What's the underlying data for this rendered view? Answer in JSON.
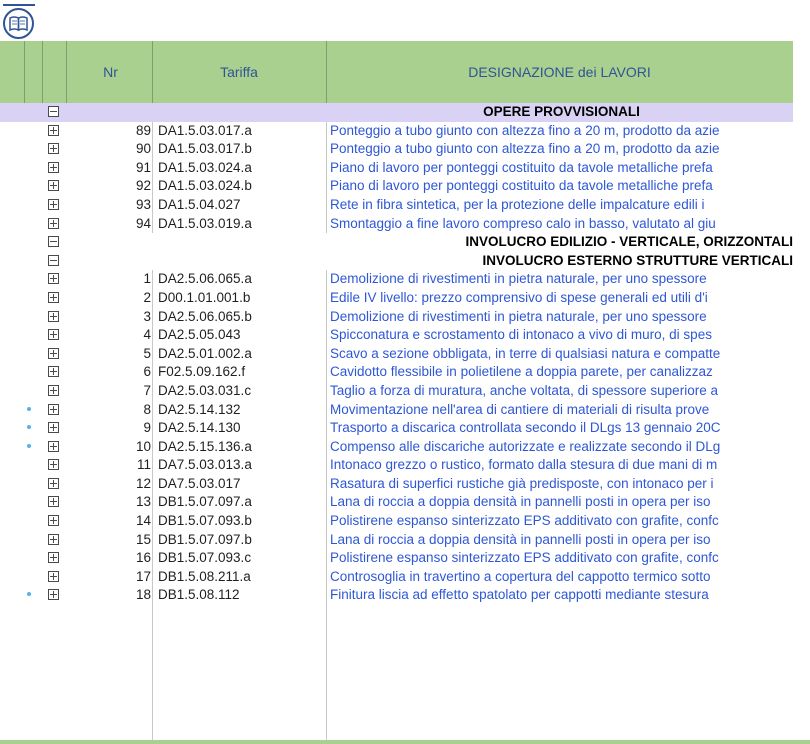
{
  "header": {
    "nr": "Nr",
    "tariffa": "Tariffa",
    "designazione": "DESIGNAZIONE dei LAVORI"
  },
  "rows": [
    {
      "kind": "section",
      "toggle": "minus",
      "title": "OPERE PROVVISIONALI",
      "align": "center",
      "highlight": true
    },
    {
      "kind": "item",
      "nr": "89",
      "tariffa": "DA1.5.03.017.a",
      "desc": "Ponteggio a tubo giunto con altezza fino a 20 m, prodotto da azie"
    },
    {
      "kind": "item",
      "nr": "90",
      "tariffa": "DA1.5.03.017.b",
      "desc": "Ponteggio a tubo giunto con altezza fino a 20 m, prodotto da azie"
    },
    {
      "kind": "item",
      "nr": "91",
      "tariffa": "DA1.5.03.024.a",
      "desc": "Piano di lavoro per ponteggi costituito da tavole metalliche prefa"
    },
    {
      "kind": "item",
      "nr": "92",
      "tariffa": "DA1.5.03.024.b",
      "desc": "Piano di lavoro per ponteggi costituito da tavole metalliche prefa"
    },
    {
      "kind": "item",
      "nr": "93",
      "tariffa": "DA1.5.04.027",
      "desc": "Rete in fibra sintetica, per la protezione delle impalcature edili i"
    },
    {
      "kind": "item",
      "nr": "94",
      "tariffa": "DA1.5.03.019.a",
      "desc": "Smontaggio a fine lavoro compreso calo in basso, valutato al giu"
    },
    {
      "kind": "section",
      "toggle": "minus",
      "title": "INVOLUCRO EDILIZIO - VERTICALE, ORIZZONTALI",
      "align": "right",
      "highlight": false
    },
    {
      "kind": "section",
      "toggle": "minus",
      "title": "INVOLUCRO ESTERNO STRUTTURE VERTICALI",
      "align": "right",
      "highlight": false
    },
    {
      "kind": "item",
      "nr": "1",
      "tariffa": "DA2.5.06.065.a",
      "desc": "Demolizione di rivestimenti in pietra naturale, per uno spessore"
    },
    {
      "kind": "item",
      "nr": "2",
      "tariffa": "D00.1.01.001.b",
      "desc": "Edile IV livello: prezzo comprensivo di spese generali ed utili d'i"
    },
    {
      "kind": "item",
      "nr": "3",
      "tariffa": "DA2.5.06.065.b",
      "desc": "Demolizione di rivestimenti in pietra naturale, per uno spessore"
    },
    {
      "kind": "item",
      "nr": "4",
      "tariffa": "DA2.5.05.043",
      "desc": "Spicconatura e scrostamento di intonaco a vivo di muro, di spes"
    },
    {
      "kind": "item",
      "nr": "5",
      "tariffa": "DA2.5.01.002.a",
      "desc": "Scavo a sezione obbligata, in terre di qualsiasi natura e compatte"
    },
    {
      "kind": "item",
      "nr": "6",
      "tariffa": "F02.5.09.162.f",
      "desc": "Cavidotto flessibile in polietilene a doppia parete, per canalizzaz"
    },
    {
      "kind": "item",
      "nr": "7",
      "tariffa": "DA2.5.03.031.c",
      "desc": "Taglio a forza di muratura, anche voltata, di spessore superiore a"
    },
    {
      "kind": "item",
      "nr": "8",
      "tariffa": "DA2.5.14.132",
      "desc": "Movimentazione nell'area di cantiere di materiali di risulta prove",
      "dot": true
    },
    {
      "kind": "item",
      "nr": "9",
      "tariffa": "DA2.5.14.130",
      "desc": "Trasporto a discarica controllata secondo il DLgs 13 gennaio 20C",
      "dot": true
    },
    {
      "kind": "item",
      "nr": "10",
      "tariffa": "DA2.5.15.136.a",
      "desc": "Compenso alle discariche autorizzate e realizzate secondo il DLg",
      "dot": true
    },
    {
      "kind": "item",
      "nr": "11",
      "tariffa": "DA7.5.03.013.a",
      "desc": "Intonaco grezzo o rustico, formato dalla stesura di due mani di m"
    },
    {
      "kind": "item",
      "nr": "12",
      "tariffa": "DA7.5.03.017",
      "desc": "Rasatura di superfici rustiche già predisposte, con intonaco per i"
    },
    {
      "kind": "item",
      "nr": "13",
      "tariffa": "DB1.5.07.097.a",
      "desc": "Lana di roccia a doppia densità in pannelli posti in opera per iso"
    },
    {
      "kind": "item",
      "nr": "14",
      "tariffa": "DB1.5.07.093.b",
      "desc": "Polistirene espanso sinterizzato EPS additivato con grafite, confc"
    },
    {
      "kind": "item",
      "nr": "15",
      "tariffa": "DB1.5.07.097.b",
      "desc": "Lana di roccia a doppia densità in pannelli posti in opera per iso"
    },
    {
      "kind": "item",
      "nr": "16",
      "tariffa": "DB1.5.07.093.c",
      "desc": "Polistirene espanso sinterizzato EPS additivato con grafite, confc"
    },
    {
      "kind": "item",
      "nr": "17",
      "tariffa": "DB1.5.08.211.a",
      "desc": "Controsoglia in travertino a copertura del cappotto termico sotto"
    },
    {
      "kind": "item",
      "nr": "18",
      "tariffa": "DB1.5.08.112",
      "desc": "Finitura liscia ad effetto spatolato per cappotti mediante stesura",
      "dot": true
    }
  ],
  "colors": {
    "header_bg": "#a9d08e",
    "header_text": "#2f5596",
    "link": "#2e57d6",
    "highlight": "#d9d2f5"
  },
  "icons": {
    "book": "book-icon",
    "expand": "plus-box-icon",
    "collapse": "minus-box-icon"
  }
}
